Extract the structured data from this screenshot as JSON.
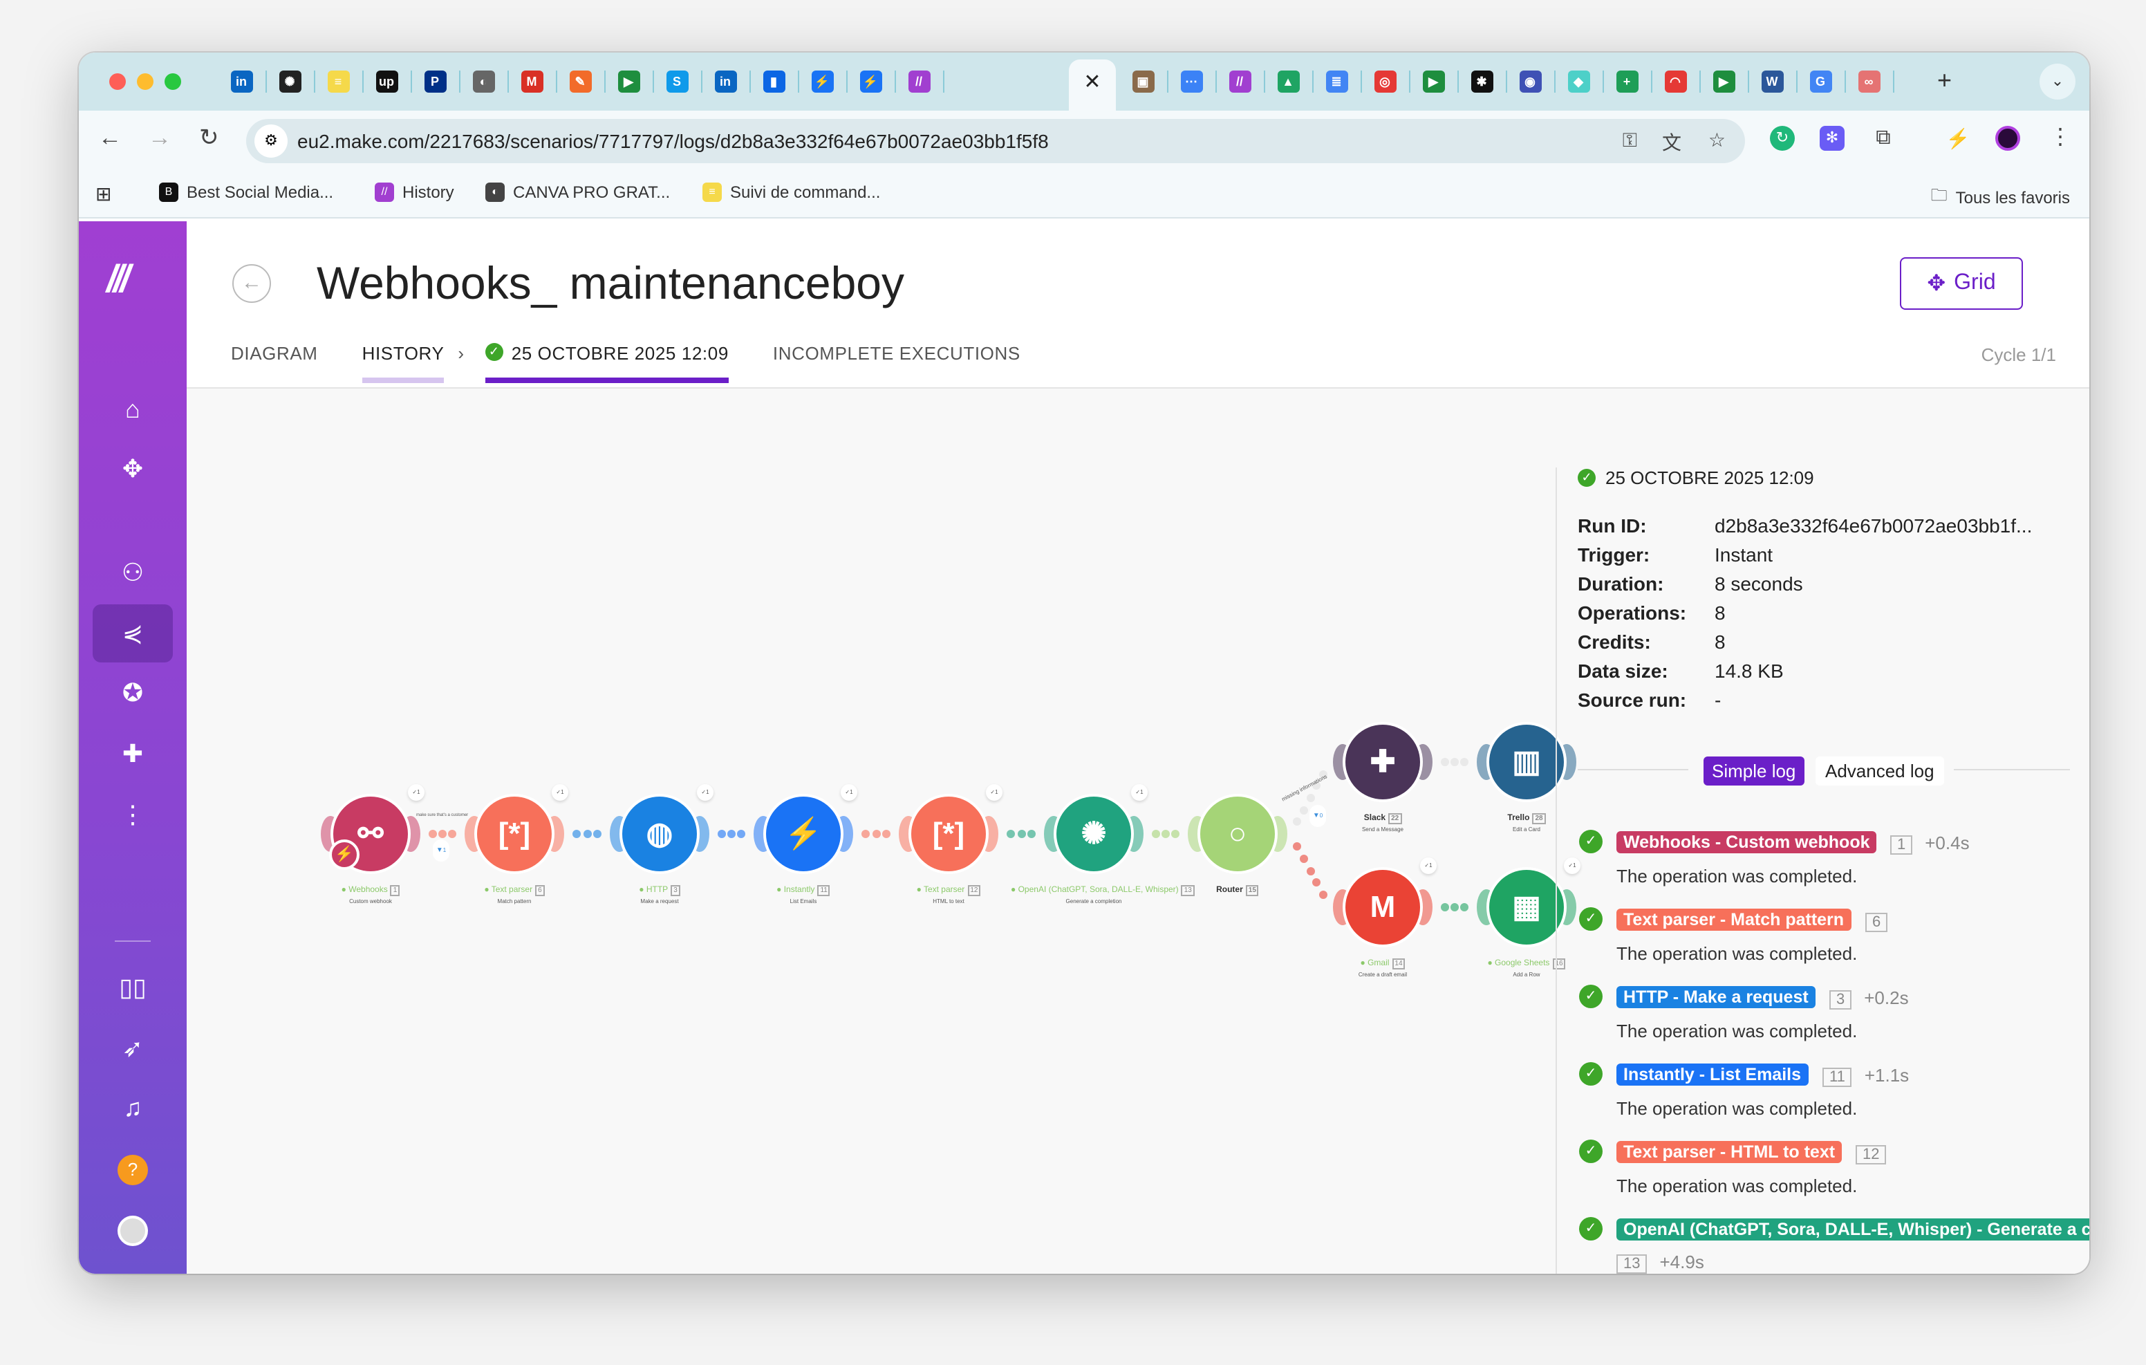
{
  "browser": {
    "tab_icons": [
      {
        "name": "linkedin",
        "glyph": "in",
        "color": "#0a66c2"
      },
      {
        "name": "openai",
        "glyph": "✺",
        "color": "#222"
      },
      {
        "name": "yellow-app",
        "glyph": "≡",
        "color": "#f5d94a"
      },
      {
        "name": "upwork",
        "glyph": "up",
        "color": "#111"
      },
      {
        "name": "paypal",
        "glyph": "P",
        "color": "#003087"
      },
      {
        "name": "canva-globe",
        "glyph": "◐",
        "color": "#666"
      },
      {
        "name": "gmail",
        "glyph": "M",
        "color": "#d93025"
      },
      {
        "name": "app-orange",
        "glyph": "✎",
        "color": "#f26b2a"
      },
      {
        "name": "google-meet",
        "glyph": "▶",
        "color": "#1e8e3e"
      },
      {
        "name": "skype",
        "glyph": "S",
        "color": "#0f9aea"
      },
      {
        "name": "linkedin",
        "glyph": "in",
        "color": "#0a66c2"
      },
      {
        "name": "trello",
        "glyph": "▮",
        "color": "#0c66e4"
      },
      {
        "name": "instantly",
        "glyph": "⚡",
        "color": "#1a73f5"
      },
      {
        "name": "instantly",
        "glyph": "⚡",
        "color": "#1a73f5"
      },
      {
        "name": "make",
        "glyph": "//",
        "color": "#a13fd0"
      }
    ],
    "active_tab_close": "✕",
    "tab_icons_right": [
      {
        "name": "photo",
        "glyph": "▣",
        "color": "#8a6a4a"
      },
      {
        "name": "dots",
        "glyph": "⋯",
        "color": "#3b82f6"
      },
      {
        "name": "make",
        "glyph": "//",
        "color": "#a13fd0"
      },
      {
        "name": "google-drive",
        "glyph": "▲",
        "color": "#1fa463"
      },
      {
        "name": "google-docs",
        "glyph": "≣",
        "color": "#4285f4"
      },
      {
        "name": "red-app",
        "glyph": "◎",
        "color": "#e53935"
      },
      {
        "name": "google-meet",
        "glyph": "▶",
        "color": "#1e8e3e"
      },
      {
        "name": "asterisk",
        "glyph": "✱",
        "color": "#111"
      },
      {
        "name": "blue-ring",
        "glyph": "◉",
        "color": "#3f51b5"
      },
      {
        "name": "gem",
        "glyph": "◆",
        "color": "#4dd0c8"
      },
      {
        "name": "google-sheets",
        "glyph": "+",
        "color": "#1e9e57"
      },
      {
        "name": "gauge",
        "glyph": "◠",
        "color": "#e53935"
      },
      {
        "name": "google-meet",
        "glyph": "▶",
        "color": "#1e8e3e"
      },
      {
        "name": "word",
        "glyph": "W",
        "color": "#2b579a"
      },
      {
        "name": "google",
        "glyph": "G",
        "color": "#4285f4"
      },
      {
        "name": "flow",
        "glyph": "∞",
        "color": "#e57373"
      }
    ],
    "new_tab": "+",
    "tab_menu": "⌄",
    "url": "eu2.make.com/2217683/scenarios/7717797/logs/d2b8a3e332f64e67b0072ae03bb1f5f8",
    "bookmarks": [
      {
        "label": "Best Social Media...",
        "glyph": "B",
        "color": "#111"
      },
      {
        "label": "History",
        "glyph": "//",
        "color": "#a13fd0"
      },
      {
        "label": "CANVA PRO GRAT...",
        "glyph": "◐",
        "color": "#444"
      },
      {
        "label": "Suivi de command...",
        "glyph": "≡",
        "color": "#f5d94a"
      }
    ],
    "all_bookmarks": "Tous les favoris"
  },
  "page": {
    "title": "Webhooks_ maintenanceboy",
    "grid_button": "Grid",
    "tabs": {
      "diagram": "DIAGRAM",
      "history": "HISTORY",
      "run": "25 OCTOBRE 2025 12:09",
      "incomplete": "INCOMPLETE EXECUTIONS"
    },
    "cycle": "Cycle 1/1"
  },
  "diagram": {
    "nodes": [
      {
        "app": "Webhooks",
        "action": "Custom webhook",
        "id": "1",
        "color": "#c83b63",
        "glyph": "⚯",
        "ok": true,
        "ops": "1"
      },
      {
        "app": "Text parser",
        "action": "Match pattern",
        "id": "6",
        "color": "#f7705a",
        "glyph": "[*]",
        "ok": true,
        "ops": "1"
      },
      {
        "app": "HTTP",
        "action": "Make a request",
        "id": "3",
        "color": "#1a82e2",
        "glyph": "◍",
        "ok": true,
        "ops": "1"
      },
      {
        "app": "Instantly",
        "action": "List Emails",
        "id": "11",
        "color": "#1a73f5",
        "glyph": "⚡",
        "ok": true,
        "ops": "1"
      },
      {
        "app": "Text parser",
        "action": "HTML to text",
        "id": "12",
        "color": "#f7705a",
        "glyph": "[*]",
        "ok": true,
        "ops": "1"
      },
      {
        "app": "OpenAI (ChatGPT, Sora, DALL-E, Whisper)",
        "action": "Generate a completion",
        "id": "13",
        "color": "#20a37f",
        "glyph": "✺",
        "ok": true,
        "ops": "1"
      },
      {
        "app": "Router",
        "action": "",
        "id": "15",
        "color": "#a5d477",
        "glyph": "○",
        "ok": false,
        "ops": ""
      },
      {
        "app": "Slack",
        "action": "Send a Message",
        "id": "22",
        "color": "#4a3458",
        "glyph": "✚",
        "ok": false,
        "ops": ""
      },
      {
        "app": "Trello",
        "action": "Edit a Card",
        "id": "28",
        "color": "#26638f",
        "glyph": "▥",
        "ok": false,
        "ops": ""
      },
      {
        "app": "Gmail",
        "action": "Create a draft email",
        "id": "14",
        "color": "#ea4335",
        "glyph": "M",
        "ok": true,
        "ops": "1"
      },
      {
        "app": "Google Sheets",
        "action": "Add a Row",
        "id": "16",
        "color": "#1fa463",
        "glyph": "▦",
        "ok": true,
        "ops": "1"
      }
    ],
    "filter1_label": "make sure that's a customer",
    "filter1_count": "1",
    "filter2_label": "missing informations",
    "filter2_count": "0"
  },
  "run": {
    "title": "25 OCTOBRE 2025 12:09",
    "details": [
      {
        "key": "Run ID:",
        "value": "d2b8a3e332f64e67b0072ae03bb1f..."
      },
      {
        "key": "Trigger:",
        "value": "Instant"
      },
      {
        "key": "Duration:",
        "value": "8 seconds"
      },
      {
        "key": "Operations:",
        "value": "8"
      },
      {
        "key": "Credits:",
        "value": "8"
      },
      {
        "key": "Data size:",
        "value": "14.8 KB"
      },
      {
        "key": "Source run:",
        "value": "-"
      }
    ],
    "simple_log": "Simple log",
    "advanced_log": "Advanced log",
    "logs": [
      {
        "module": "Webhooks - Custom webhook",
        "id": "1",
        "time": "+0.4s",
        "message": "The operation was completed.",
        "color": "#c83b63"
      },
      {
        "module": "Text parser - Match pattern",
        "id": "6",
        "time": "",
        "message": "The operation was completed.",
        "color": "#f7705a"
      },
      {
        "module": "HTTP - Make a request",
        "id": "3",
        "time": "+0.2s",
        "message": "The operation was completed.",
        "color": "#1a82e2"
      },
      {
        "module": "Instantly - List Emails",
        "id": "11",
        "time": "+1.1s",
        "message": "The operation was completed.",
        "color": "#1a73f5"
      },
      {
        "module": "Text parser - HTML to text",
        "id": "12",
        "time": "",
        "message": "The operation was completed.",
        "color": "#f7705a"
      },
      {
        "module": "OpenAI (ChatGPT, Sora, DALL-E, Whisper) - Generate a completion",
        "id": "13",
        "time": "+4.9s",
        "message": "",
        "color": "#20a37f"
      }
    ]
  }
}
